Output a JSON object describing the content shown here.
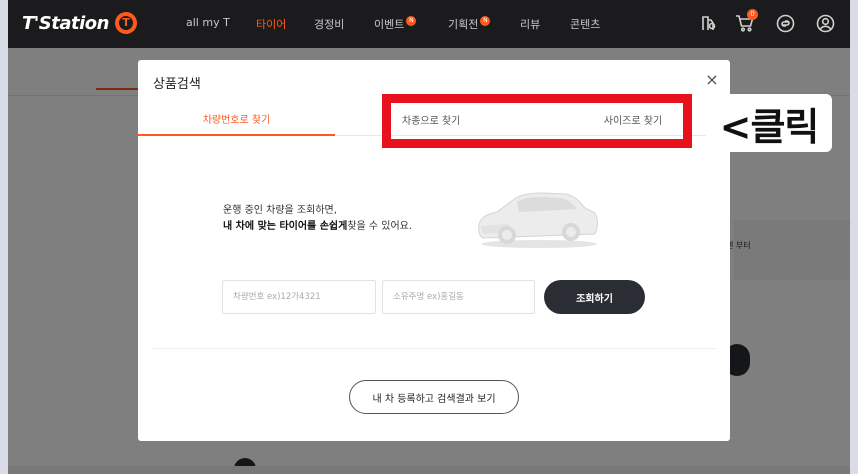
{
  "nav": {
    "logo": "T'Station",
    "logo_mark": "T",
    "items": [
      {
        "label": "all my T",
        "active": false,
        "badge": ""
      },
      {
        "label": "타이어",
        "active": true,
        "badge": ""
      },
      {
        "label": "경정비",
        "active": false,
        "badge": ""
      },
      {
        "label": "이벤트",
        "active": false,
        "badge": "N"
      },
      {
        "label": "기획전",
        "active": false,
        "badge": "N"
      },
      {
        "label": "리뷰",
        "active": false,
        "badge": ""
      },
      {
        "label": "콘텐츠",
        "active": false,
        "badge": ""
      }
    ],
    "cart_count": "0",
    "icons": [
      "store-search-icon",
      "cart-icon",
      "link-icon",
      "user-icon"
    ]
  },
  "background": {
    "card_text": "렌 부터"
  },
  "modal": {
    "title": "상품검색",
    "close": "×",
    "tabs": [
      {
        "label": "차량번호로 찾기",
        "active": true
      },
      {
        "label": "차종으로 찾기",
        "active": false
      },
      {
        "label": "사이즈로 찾기",
        "active": false
      }
    ],
    "desc_line1": "운행 중인 차량을 조회하면,",
    "desc_line2_bold": "내 차에 맞는 타이어를 손쉽게",
    "desc_line2_rest": "찾을 수 있어요.",
    "plate_placeholder": "차량번호 ex)12가4321",
    "owner_placeholder": "소유주명 ex)홍길동",
    "search_button": "조회하기",
    "register_button": "내 차 등록하고 검색결과 보기"
  },
  "annotation": {
    "callout_text": "<클릭",
    "highlight_color": "#e8121c"
  },
  "colors": {
    "accent": "#ff5a1e",
    "nav_bg": "#1b1b1d",
    "dark_button": "#2a2d34"
  }
}
